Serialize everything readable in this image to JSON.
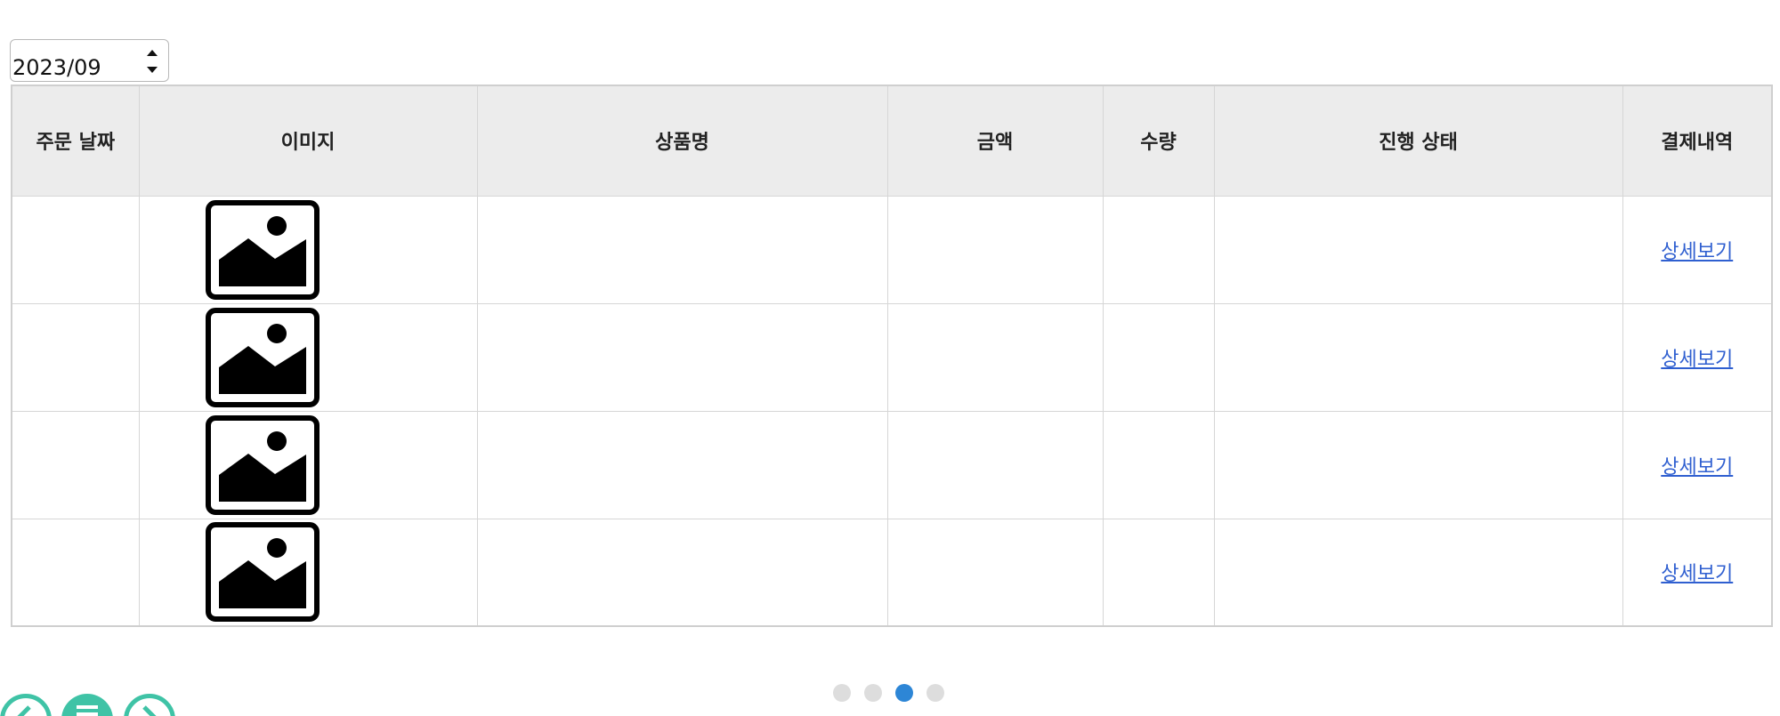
{
  "month_picker": {
    "value": "2023/09"
  },
  "table": {
    "headers": [
      "주문 날짜",
      "이미지",
      "상품명",
      "금액",
      "수량",
      "진행 상태",
      "결제내역"
    ],
    "rows": [
      {
        "order_date": "",
        "image": "image-placeholder-icon",
        "product_name": "",
        "amount": "",
        "quantity": "",
        "status": "",
        "payment_detail": "상세보기"
      },
      {
        "order_date": "",
        "image": "image-placeholder-icon",
        "product_name": "",
        "amount": "",
        "quantity": "",
        "status": "",
        "payment_detail": "상세보기"
      },
      {
        "order_date": "",
        "image": "image-placeholder-icon",
        "product_name": "",
        "amount": "",
        "quantity": "",
        "status": "",
        "payment_detail": "상세보기"
      },
      {
        "order_date": "",
        "image": "image-placeholder-icon",
        "product_name": "",
        "amount": "",
        "quantity": "",
        "status": "",
        "payment_detail": "상세보기"
      }
    ]
  },
  "pager": {
    "total": 4,
    "active_index": 2
  },
  "nav_buttons": {
    "icons": [
      "arrow-left-circle-icon",
      "menu-circle-icon",
      "arrow-right-circle-icon"
    ]
  },
  "colors": {
    "header_bg": "#ececec",
    "link": "#2f5fd0",
    "dot_active": "#2d86d6",
    "dot_inactive": "#dddddd",
    "nav_accent": "#3fc3a6"
  }
}
